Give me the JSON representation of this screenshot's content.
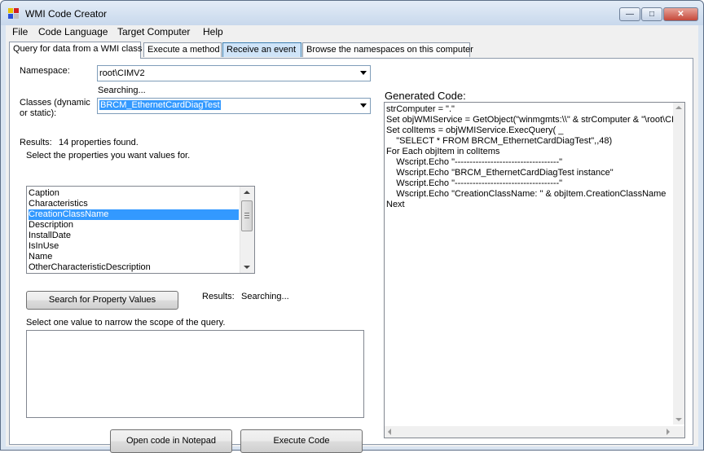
{
  "window": {
    "title": "WMI Code Creator"
  },
  "menu": [
    "File",
    "Code Language",
    "Target Computer",
    "Help"
  ],
  "tabs": [
    "Query for data from a WMI class",
    "Execute a method",
    "Receive an event",
    "Browse the namespaces on this computer"
  ],
  "query": {
    "namespace_label": "Namespace:",
    "namespace_value": "root\\CIMV2",
    "searching_status": "Searching...",
    "classes_label_line1": "Classes (dynamic",
    "classes_label_line2": "or static):",
    "class_value": "BRCM_EthernetCardDiagTest",
    "results_label": "Results:",
    "results_count": "14 properties found.",
    "select_properties_text": "Select the properties you want values for.",
    "properties": [
      "Caption",
      "Characteristics",
      "CreationClassName",
      "Description",
      "InstallDate",
      "IsInUse",
      "Name",
      "OtherCharacteristicDescription"
    ],
    "selected_property": "CreationClassName",
    "search_button": "Search for Property Values",
    "results2_label": "Results:",
    "results2_status": "Searching...",
    "narrow_scope_text": "Select one value to narrow the scope of the query.",
    "open_notepad_button": "Open code in Notepad",
    "execute_button": "Execute Code"
  },
  "code": {
    "label": "Generated Code:",
    "lines": [
      "strComputer = \".\"",
      "Set objWMIService = GetObject(\"winmgmts:\\\\\" & strComputer & \"\\root\\CIMV",
      "Set colItems = objWMIService.ExecQuery( _",
      "    \"SELECT * FROM BRCM_EthernetCardDiagTest\",,48)",
      "For Each objItem in colItems",
      "    Wscript.Echo \"-----------------------------------\"",
      "    Wscript.Echo \"BRCM_EthernetCardDiagTest instance\"",
      "    Wscript.Echo \"-----------------------------------\"",
      "    Wscript.Echo \"CreationClassName: \" & objItem.CreationClassName",
      "Next"
    ]
  },
  "colors": {
    "selection": "#3399ff",
    "frame": "#d9e4f1",
    "close": "#c5483a"
  }
}
